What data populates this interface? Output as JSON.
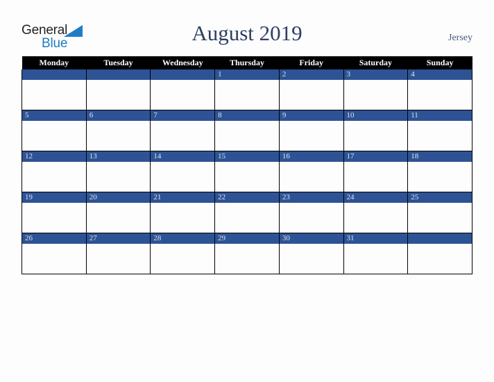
{
  "brand": {
    "line1": "General",
    "line2": "Blue",
    "triangle_icon": "triangle-icon",
    "text_color": "#231f20",
    "accent_color": "#1f7dc4"
  },
  "header": {
    "title": "August 2019",
    "region": "Jersey",
    "title_color": "#2c3f64",
    "region_color": "#47587d"
  },
  "calendar": {
    "month": "August",
    "year": "2019",
    "header_bg": "#000000",
    "header_text_color": "#ffffff",
    "day_bar_bg": "#2e5395",
    "day_number_color": "#dfe4ee",
    "cell_bg": "#fdfdfd",
    "grid_line_color": "#000000",
    "weekdays": [
      "Monday",
      "Tuesday",
      "Wednesday",
      "Thursday",
      "Friday",
      "Saturday",
      "Sunday"
    ],
    "weeks": [
      [
        "",
        "",
        "",
        "1",
        "2",
        "3",
        "4"
      ],
      [
        "5",
        "6",
        "7",
        "8",
        "9",
        "10",
        "11"
      ],
      [
        "12",
        "13",
        "14",
        "15",
        "16",
        "17",
        "18"
      ],
      [
        "19",
        "20",
        "21",
        "22",
        "23",
        "24",
        "25"
      ],
      [
        "26",
        "27",
        "28",
        "29",
        "30",
        "31",
        ""
      ]
    ]
  }
}
